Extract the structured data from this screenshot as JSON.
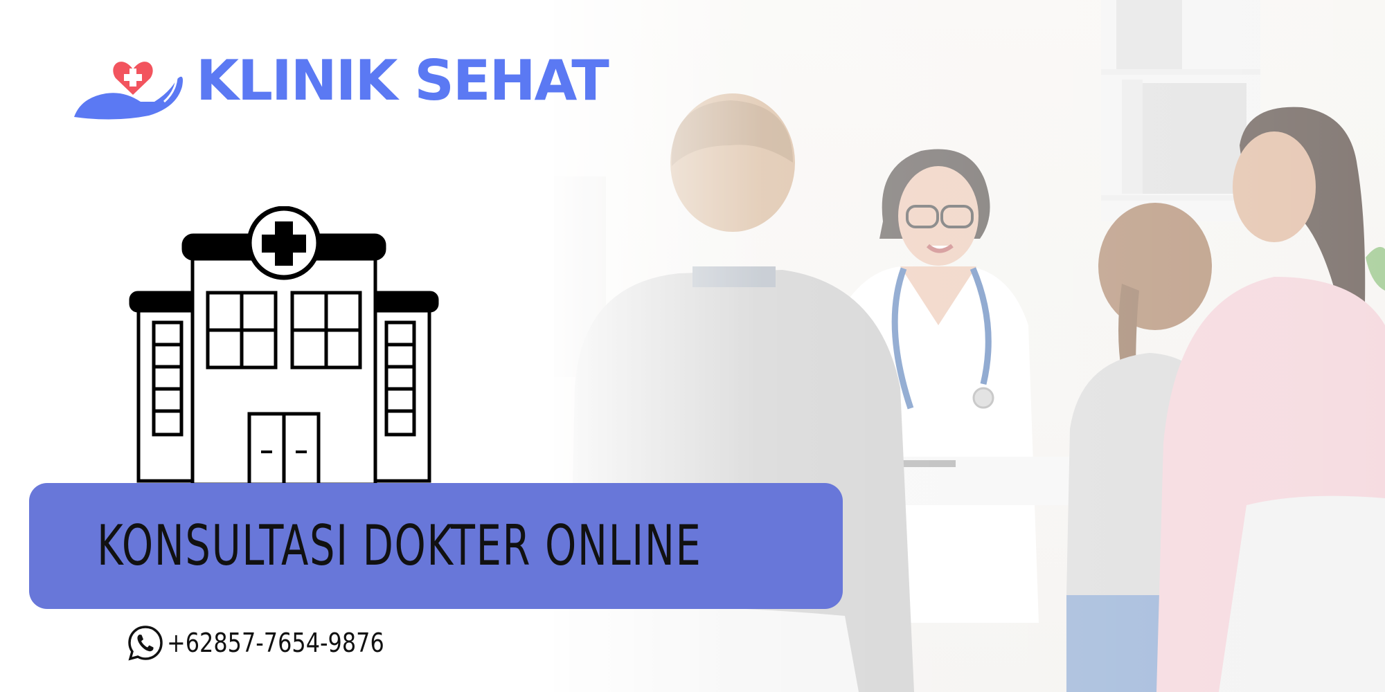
{
  "brand": {
    "name": "KLINIK SEHAT",
    "logo_icon": "heart-cross-in-hand-icon",
    "color": "#5b79f3",
    "heart_color": "#f2545e"
  },
  "illustration": {
    "icon": "hospital-building-icon",
    "color": "#000000"
  },
  "headline": {
    "text": "KONSULTASI DOKTER ONLINE",
    "background": "#6877d9"
  },
  "contact": {
    "phone_icon": "whatsapp-icon",
    "phone": "+62857-7654-9876"
  },
  "photo": {
    "description_icon": "doctor-consultation-photo"
  }
}
